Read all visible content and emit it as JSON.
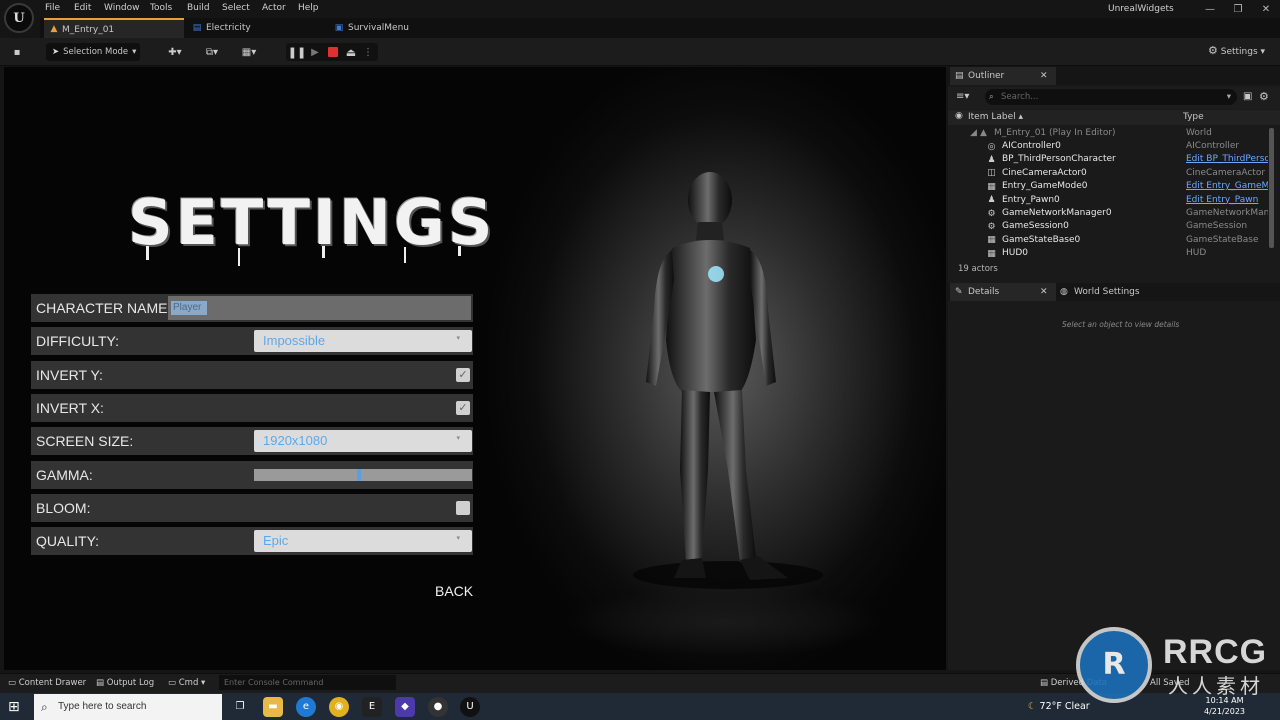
{
  "menu": {
    "items": [
      "File",
      "Edit",
      "Window",
      "Tools",
      "Build",
      "Select",
      "Actor",
      "Help"
    ],
    "project_name": "UnrealWidgets"
  },
  "tabs": [
    {
      "label": "M_Entry_01",
      "icon": "level-icon"
    },
    {
      "label": "Electricity",
      "icon": "blueprint-icon"
    },
    {
      "label": "SurvivalMenu",
      "icon": "widget-icon"
    }
  ],
  "toolbar": {
    "selection_mode": "Selection Mode",
    "settings": "Settings"
  },
  "game_ui": {
    "title": "SETTINGS",
    "rows": [
      {
        "label": "CHARACTER NAME:",
        "kind": "text",
        "value": "Player"
      },
      {
        "label": "DIFFICULTY:",
        "kind": "combo",
        "value": "Impossible"
      },
      {
        "label": "INVERT Y:",
        "kind": "check",
        "checked": true
      },
      {
        "label": "INVERT X:",
        "kind": "check",
        "checked": true
      },
      {
        "label": "SCREEN SIZE:",
        "kind": "combo",
        "value": "1920x1080"
      },
      {
        "label": "GAMMA:",
        "kind": "slider",
        "value": 0.48
      },
      {
        "label": "BLOOM:",
        "kind": "check",
        "checked": false
      },
      {
        "label": "QUALITY:",
        "kind": "combo",
        "value": "Epic"
      }
    ],
    "back": "BACK",
    "check_glyph": "✓",
    "combo_arrow": "▾"
  },
  "outliner": {
    "tab": "Outliner",
    "search_placeholder": "Search...",
    "col_label": "Item Label ▴",
    "col_type": "Type",
    "root": {
      "label": "M_Entry_01 (Play In Editor)",
      "type": "World"
    },
    "items": [
      {
        "label": "AIController0",
        "type": "AIController",
        "link": false
      },
      {
        "label": "BP_ThirdPersonCharacter",
        "type": "Edit BP_ThirdPersonCharacter",
        "link": true
      },
      {
        "label": "CineCameraActor0",
        "type": "CineCameraActor",
        "link": false
      },
      {
        "label": "Entry_GameMode0",
        "type": "Edit Entry_GameMode",
        "link": true
      },
      {
        "label": "Entry_Pawn0",
        "type": "Edit Entry_Pawn",
        "link": true
      },
      {
        "label": "GameNetworkManager0",
        "type": "GameNetworkManager",
        "link": false
      },
      {
        "label": "GameSession0",
        "type": "GameSession",
        "link": false
      },
      {
        "label": "GameStateBase0",
        "type": "GameStateBase",
        "link": false
      },
      {
        "label": "HUD0",
        "type": "HUD",
        "link": false
      }
    ],
    "count": "19 actors"
  },
  "details": {
    "tab": "Details",
    "world_tab": "World Settings",
    "empty": "Select an object to view details"
  },
  "bottom": {
    "content_drawer": "Content Drawer",
    "output_log": "Output Log",
    "cmd": "Cmd",
    "console_placeholder": "Enter Console Command",
    "derived": "Derived Data",
    "all_saved": "All Saved"
  },
  "taskbar": {
    "search": "Type here to search",
    "weather": "72°F  Clear",
    "time": "10:14 AM",
    "date": "4/21/2023"
  },
  "watermark": {
    "logo": "R",
    "brand": "RRCG",
    "sub": "人人素材"
  },
  "colors": {
    "accent": "#e8a13a",
    "link": "#6aa9ff",
    "combo_text": "#5fa8e8",
    "stop": "#e03030"
  }
}
